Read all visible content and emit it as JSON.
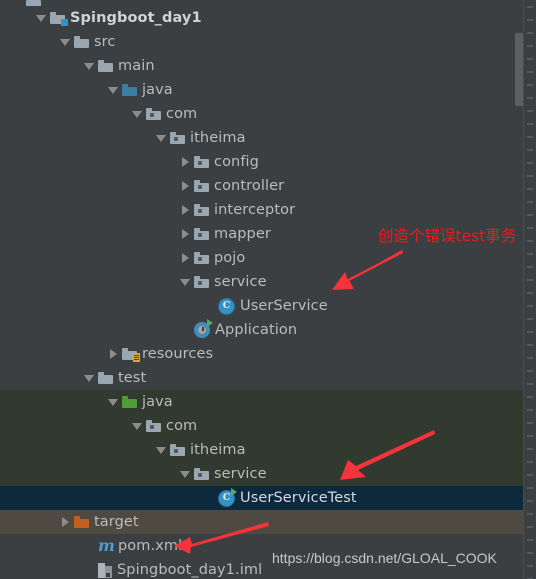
{
  "window": {
    "background_color": "#3c3f41",
    "selected_row_color": "#0d293e",
    "test_scope_color": "#32392f",
    "target_scope_color": "#4e4a42"
  },
  "tree": {
    "rows": [
      {
        "indent": 0,
        "arrow": "none",
        "icon": "folder-gray-partial",
        "label": "",
        "type": "partial-top"
      },
      {
        "indent": 1,
        "arrow": "down",
        "icon": "module-folder",
        "label": "Spingboot_day1",
        "type": "module",
        "bold": true
      },
      {
        "indent": 2,
        "arrow": "down",
        "icon": "folder-gray",
        "label": "src",
        "type": "folder"
      },
      {
        "indent": 3,
        "arrow": "down",
        "icon": "folder-gray",
        "label": "main",
        "type": "folder"
      },
      {
        "indent": 4,
        "arrow": "down",
        "icon": "folder-blue",
        "label": "java",
        "type": "source-root"
      },
      {
        "indent": 5,
        "arrow": "down",
        "icon": "package",
        "label": "com",
        "type": "package"
      },
      {
        "indent": 6,
        "arrow": "down",
        "icon": "package",
        "label": "itheima",
        "type": "package"
      },
      {
        "indent": 7,
        "arrow": "right",
        "icon": "package",
        "label": "config",
        "type": "package"
      },
      {
        "indent": 7,
        "arrow": "right",
        "icon": "package",
        "label": "controller",
        "type": "package"
      },
      {
        "indent": 7,
        "arrow": "right",
        "icon": "package",
        "label": "interceptor",
        "type": "package"
      },
      {
        "indent": 7,
        "arrow": "right",
        "icon": "package",
        "label": "mapper",
        "type": "package"
      },
      {
        "indent": 7,
        "arrow": "right",
        "icon": "package",
        "label": "pojo",
        "type": "package"
      },
      {
        "indent": 7,
        "arrow": "down",
        "icon": "package",
        "label": "service",
        "type": "package"
      },
      {
        "indent": 8,
        "arrow": "none",
        "icon": "class-icon",
        "label": "UserService",
        "type": "class"
      },
      {
        "indent": 7,
        "arrow": "none",
        "icon": "spring-run-icon",
        "label": "Application",
        "type": "class-runnable"
      },
      {
        "indent": 4,
        "arrow": "right",
        "icon": "folder-resources",
        "label": "resources",
        "type": "resource-root"
      },
      {
        "indent": 3,
        "arrow": "down",
        "icon": "folder-gray",
        "label": "test",
        "type": "folder"
      },
      {
        "indent": 4,
        "arrow": "down",
        "icon": "folder-green",
        "label": "java",
        "type": "test-source-root",
        "scope": "test"
      },
      {
        "indent": 5,
        "arrow": "down",
        "icon": "package",
        "label": "com",
        "type": "package",
        "scope": "test"
      },
      {
        "indent": 6,
        "arrow": "down",
        "icon": "package",
        "label": "itheima",
        "type": "package",
        "scope": "test"
      },
      {
        "indent": 7,
        "arrow": "down",
        "icon": "package",
        "label": "service",
        "type": "package",
        "scope": "test"
      },
      {
        "indent": 8,
        "arrow": "none",
        "icon": "test-class-run-icon",
        "label": "UserServiceTest",
        "type": "test-class",
        "selected": true
      },
      {
        "indent": 2,
        "arrow": "right",
        "icon": "folder-orange",
        "label": "target",
        "type": "excluded-folder",
        "scope": "target"
      },
      {
        "indent": 3,
        "arrow": "none",
        "icon": "maven-icon",
        "label": "pom.xml",
        "type": "file"
      },
      {
        "indent": 3,
        "arrow": "none",
        "icon": "iml-icon",
        "label": "Spingboot_day1.iml",
        "type": "file"
      }
    ]
  },
  "annotations": [
    {
      "name": "note-create-error-test",
      "text": "创造个错误test事务",
      "color": "#ee1b1b"
    },
    {
      "name": "arrow-to-userservice",
      "color": "#f5333a"
    },
    {
      "name": "arrow-to-userservicetest",
      "color": "#f5333a"
    },
    {
      "name": "arrow-to-pomxml",
      "color": "#f5333a"
    }
  ],
  "watermark": {
    "text": "https://blog.csdn.net/GLOAL_COOK"
  },
  "scrollbar": {
    "orientation": "vertical",
    "thumb_color": "#5c5f61"
  }
}
